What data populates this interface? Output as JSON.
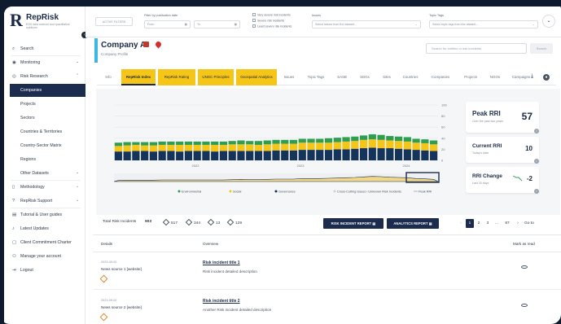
{
  "app": {
    "logo_mark": "R",
    "logo_text": "RepRisk",
    "logo_sub": "ESG data science and quantitative solutions",
    "collapse_icon": "chevron-left-icon"
  },
  "sidebar": {
    "items": [
      {
        "label": "Search",
        "icon": "search-icon",
        "chev": ""
      },
      {
        "label": "Monitoring",
        "icon": "eye-icon",
        "chev": "v"
      },
      {
        "label": "Risk Research",
        "icon": "target-icon",
        "chev": "^"
      },
      {
        "label": "Companies",
        "icon": "",
        "chev": ""
      },
      {
        "label": "Projects",
        "icon": "",
        "chev": ""
      },
      {
        "label": "Sectors",
        "icon": "",
        "chev": ""
      },
      {
        "label": "Countries & Territories",
        "icon": "",
        "chev": ""
      },
      {
        "label": "Country-Sector Matrix",
        "icon": "",
        "chev": ""
      },
      {
        "label": "Regions",
        "icon": "",
        "chev": ""
      },
      {
        "label": "Other Datasets",
        "icon": "",
        "chev": "v"
      },
      {
        "label": "Methodology",
        "icon": "book-icon",
        "chev": "v"
      },
      {
        "label": "RepRisk Support",
        "icon": "help-icon",
        "chev": "v"
      },
      {
        "label": "Tutorial & User guides",
        "icon": "doc-icon",
        "chev": ""
      },
      {
        "label": "Latest Updates",
        "icon": "bell-icon",
        "chev": ""
      },
      {
        "label": "Client Commitment Charter",
        "icon": "file-icon",
        "chev": ""
      },
      {
        "label": "Manage your account",
        "icon": "user-icon",
        "chev": ""
      },
      {
        "label": "Logout",
        "icon": "logout-icon",
        "chev": ""
      }
    ]
  },
  "topbar": {
    "filter_btn": "ACTIVE FILTERS",
    "pub_date_label": "Filter by publication date",
    "from_placeholder": "From",
    "to_placeholder": "To",
    "checks": [
      "Very severe risk incidents",
      "Severe risk incidents",
      "Least severe risk incidents"
    ],
    "issues_label": "Issues",
    "issues_placeholder": "Select issues from the dataset...",
    "topic_label": "Topic Tags",
    "topic_placeholder": "Select topic tags from the dataset..."
  },
  "company": {
    "name": "Company A",
    "subtitle": "Company Profile",
    "search_placeholder": "Search for entities or risk incidents",
    "search_btn": "Search"
  },
  "tabs": [
    "Info",
    "RepRisk Index",
    "RepRisk Rating",
    "UNGC Principles",
    "Geospatial Analytics",
    "Issues",
    "Topic Tags",
    "SASB",
    "SDGs",
    "Sites",
    "Countries",
    "Companies",
    "Projects",
    "NGOs",
    "Campaigns"
  ],
  "chart_data": {
    "type": "bar",
    "series": [
      {
        "name": "Environmental",
        "color": "#2e9e4f"
      },
      {
        "name": "Social",
        "color": "#f5c518"
      },
      {
        "name": "Governance",
        "color": "#14345c"
      },
      {
        "name": "Cross-Cutting Issues / Unknown Risk Incidents",
        "color": "#c9d3de"
      },
      {
        "name": "Peak RRI",
        "color": "#9aa3af"
      }
    ],
    "yticks": [
      "0",
      "20",
      "40",
      "60",
      "80",
      "100"
    ],
    "xticks": [
      "2022",
      "2023",
      "2024"
    ],
    "governance": [
      16,
      16,
      17,
      17,
      16,
      17,
      17,
      16,
      17,
      17,
      17,
      16,
      17,
      17,
      17,
      17,
      17,
      17,
      18,
      18,
      18,
      19,
      19,
      19,
      19,
      20,
      20,
      21,
      22,
      23,
      22,
      22,
      21,
      20,
      19,
      18,
      17
    ],
    "social": [
      10,
      11,
      11,
      10,
      11,
      11,
      11,
      12,
      11,
      11,
      11,
      12,
      11,
      12,
      12,
      12,
      11,
      12,
      12,
      12,
      12,
      13,
      13,
      13,
      13,
      13,
      14,
      14,
      15,
      15,
      15,
      14,
      14,
      14,
      13,
      13,
      12
    ],
    "environmental": [
      6,
      6,
      5,
      6,
      6,
      6,
      6,
      6,
      6,
      6,
      6,
      6,
      6,
      6,
      7,
      6,
      7,
      7,
      7,
      7,
      7,
      7,
      7,
      7,
      8,
      8,
      8,
      8,
      8,
      9,
      9,
      8,
      8,
      8,
      7,
      7,
      7
    ]
  },
  "metrics": {
    "peak_title": "Peak RRI",
    "peak_sub": "Over the past two years",
    "peak_val": "57",
    "current_title": "Current RRI",
    "current_sub": "Today's date",
    "current_val": "10",
    "change_title": "RRI Change",
    "change_sub": "Last 30 days",
    "change_val": "-2"
  },
  "summary": {
    "label": "Total Risk Incidents",
    "total": "903",
    "c1": "517",
    "c2": "344",
    "c3": "13",
    "c4": "129",
    "btn_incident": "RISK INCIDENT REPORT",
    "btn_analytics": "ANALYTICS REPORT",
    "pages": [
      "1",
      "2",
      "3",
      "...",
      "87"
    ],
    "goto": "Go to"
  },
  "table": {
    "headers": [
      "Details",
      "Overview",
      "Mark as read"
    ],
    "rows": [
      {
        "date": "2023-09-02",
        "source": "News source 1 [website]",
        "title": "Risk incident title 1",
        "desc": "Risk incident detailed description"
      },
      {
        "date": "2023-09-02",
        "source": "News source 2 [website]",
        "title": "Risk incident title 2",
        "desc": "Another Risk incident detailed description"
      }
    ]
  }
}
